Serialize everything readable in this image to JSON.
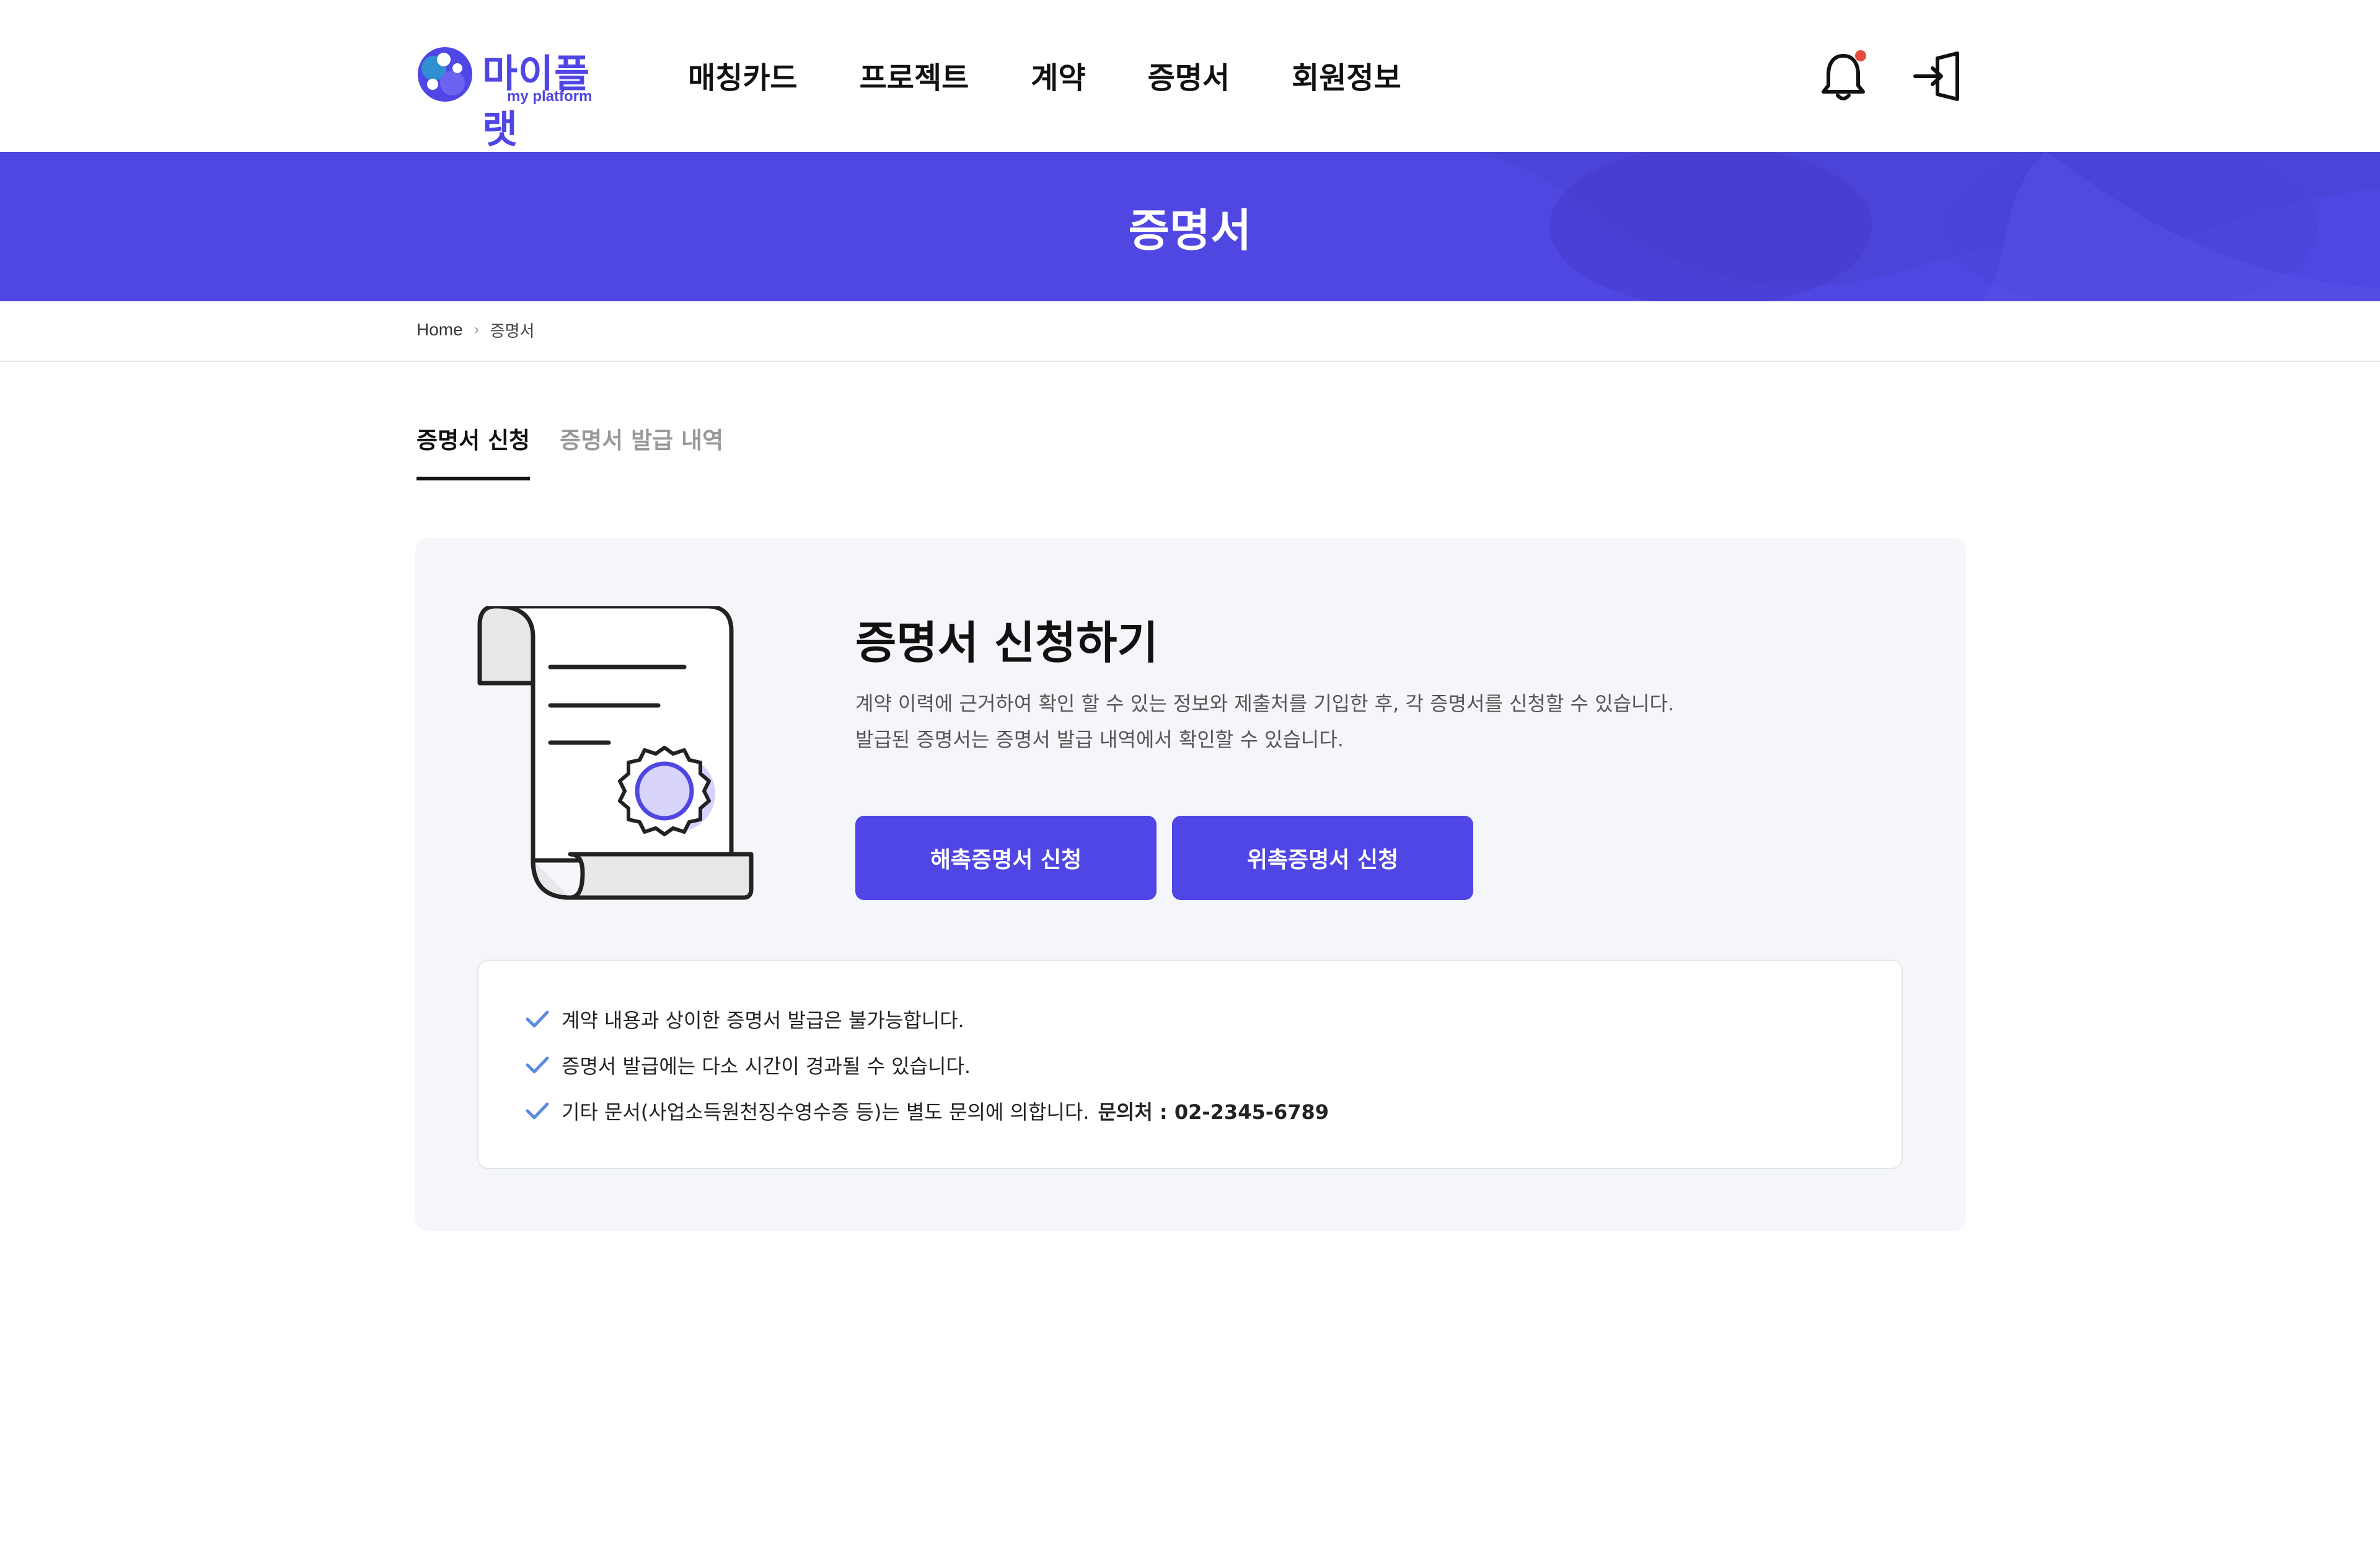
{
  "header": {
    "logo_text": "마이플랫",
    "logo_sub": "my platform",
    "nav": [
      "매칭카드",
      "프로젝트",
      "계약",
      "증명서",
      "회원정보"
    ],
    "icons": [
      "bell-icon",
      "login-icon"
    ],
    "notification_dot_color": "#e54b3c"
  },
  "banner": {
    "title": "증명서",
    "color": "#5046e1"
  },
  "breadcrumb": {
    "home": "Home",
    "separator": "›",
    "current": "증명서"
  },
  "tabs": [
    {
      "label": "증명서 신청",
      "active": true
    },
    {
      "label": "증명서 발급 내역",
      "active": false
    }
  ],
  "apply": {
    "title": "증명서 신청하기",
    "desc_line1": "계약 이력에 근거하여 확인 할 수 있는 정보와 제출처를 기입한 후, 각 증명서를 신청할 수 있습니다.",
    "desc_line2": "발급된 증명서는 증명서 발급 내역에서 확인할 수 있습니다.",
    "buttons": [
      "해촉증명서 신청",
      "위촉증명서 신청"
    ]
  },
  "notices": [
    {
      "text": "계약 내용과 상이한 증명서 발급은 불가능합니다."
    },
    {
      "text": "증명서 발급에는 다소 시간이 경과될 수 있습니다."
    },
    {
      "text": "기타 문서(사업소득원천징수영수증 등)는 별도 문의에 의합니다.",
      "contact": "문의처 : 02-2345-6789"
    }
  ],
  "colors": {
    "accent": "#4f46e5",
    "panel_bg": "#f5f6fa",
    "check": "#5b8be0"
  }
}
